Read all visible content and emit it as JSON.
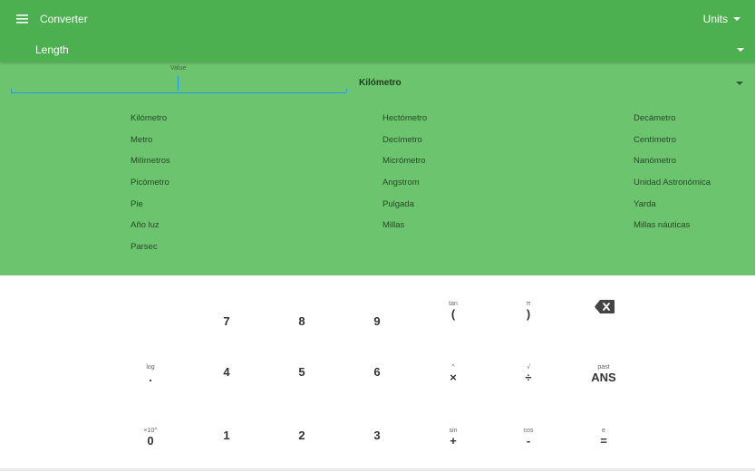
{
  "app": {
    "title": "Converter",
    "units_menu_label": "Units"
  },
  "category": {
    "selected": "Length"
  },
  "input": {
    "label": "Value",
    "value": "",
    "to_unit": "Kilómetro"
  },
  "unit_columns": [
    [
      "Kilómetro",
      "Metro",
      "Milímetros",
      "Picómetro",
      "Pie",
      "Año luz",
      "Parsec"
    ],
    [
      "Hectómetro",
      "Decímetro",
      "Micrómetro",
      "Angstrom",
      "Pulgada",
      "Millas"
    ],
    [
      "Decámetro",
      "Centímetro",
      "Nanómetro",
      "Unidad Astronómica",
      "Yarda",
      "Millas náuticas"
    ]
  ],
  "keypad": {
    "row1": [
      {
        "secondary": "",
        "primary": "7"
      },
      {
        "secondary": "",
        "primary": "8"
      },
      {
        "secondary": "",
        "primary": "9"
      },
      {
        "secondary": "tan",
        "primary": "("
      },
      {
        "secondary": "π",
        "primary": ")"
      },
      {
        "secondary": "",
        "primary": "",
        "icon": "backspace-icon"
      }
    ],
    "row2": [
      {
        "secondary": "log",
        "primary": "."
      },
      {
        "secondary": "",
        "primary": "4"
      },
      {
        "secondary": "",
        "primary": "5"
      },
      {
        "secondary": "",
        "primary": "6"
      },
      {
        "secondary": "^",
        "primary": "×"
      },
      {
        "secondary": "√",
        "primary": "÷"
      },
      {
        "secondary": "past",
        "primary": "ANS"
      }
    ],
    "row3": [
      {
        "secondary": "×10^",
        "primary": "0"
      },
      {
        "secondary": "",
        "primary": "1"
      },
      {
        "secondary": "",
        "primary": "2"
      },
      {
        "secondary": "",
        "primary": "3"
      },
      {
        "secondary": "sin",
        "primary": "+"
      },
      {
        "secondary": "cos",
        "primary": "-"
      },
      {
        "secondary": "e",
        "primary": "="
      }
    ]
  },
  "colors": {
    "appbar": "#4caf50",
    "panel": "#6dc46f",
    "input_accent": "#2196f3",
    "keypad_bg": "#ffffff"
  }
}
